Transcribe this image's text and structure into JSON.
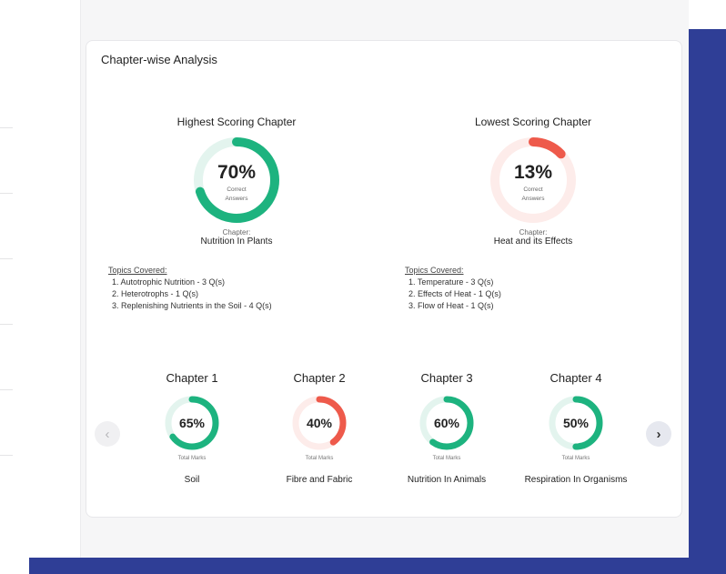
{
  "colors": {
    "brand_blue": "#2f3e96",
    "good_green": "#1db37f",
    "good_track": "#e3f4ee",
    "bad_red": "#ee5a4b",
    "bad_track": "#fdecea"
  },
  "card": {
    "title": "Chapter-wise Analysis"
  },
  "highest": {
    "heading": "Highest Scoring Chapter",
    "percent_text": "70%",
    "percent_value": 70,
    "caption_line1": "Correct",
    "caption_line2": "Answers",
    "chapter_label": "Chapter:",
    "chapter_name": "Nutrition In Plants",
    "topics_title": "Topics Covered:",
    "topics": [
      "1. Autotrophic Nutrition - 3 Q(s)",
      "2. Heterotrophs - 1 Q(s)",
      "3. Replenishing Nutrients in the Soil - 4 Q(s)"
    ]
  },
  "lowest": {
    "heading": "Lowest Scoring Chapter",
    "percent_text": "13%",
    "percent_value": 13,
    "caption_line1": "Correct",
    "caption_line2": "Answers",
    "chapter_label": "Chapter:",
    "chapter_name": "Heat and its Effects",
    "topics_title": "Topics Covered:",
    "topics": [
      "1. Temperature - 3 Q(s)",
      "2. Effects of Heat - 1 Q(s)",
      "3. Flow of Heat - 1 Q(s)"
    ]
  },
  "chapters": [
    {
      "title": "Chapter 1",
      "percent_text": "65%",
      "percent_value": 65,
      "color": "green",
      "marks_label": "Total Marks",
      "name": "Soil"
    },
    {
      "title": "Chapter 2",
      "percent_text": "40%",
      "percent_value": 40,
      "color": "red",
      "marks_label": "Total Marks",
      "name": "Fibre and Fabric"
    },
    {
      "title": "Chapter 3",
      "percent_text": "60%",
      "percent_value": 60,
      "color": "green",
      "marks_label": "Total Marks",
      "name": "Nutrition In Animals"
    },
    {
      "title": "Chapter 4",
      "percent_text": "50%",
      "percent_value": 50,
      "color": "green",
      "marks_label": "Total Marks",
      "name": "Respiration In Organisms"
    }
  ],
  "nav": {
    "prev_icon": "chevron-left-icon",
    "prev_glyph": "‹",
    "next_icon": "chevron-right-icon",
    "next_glyph": "›"
  }
}
